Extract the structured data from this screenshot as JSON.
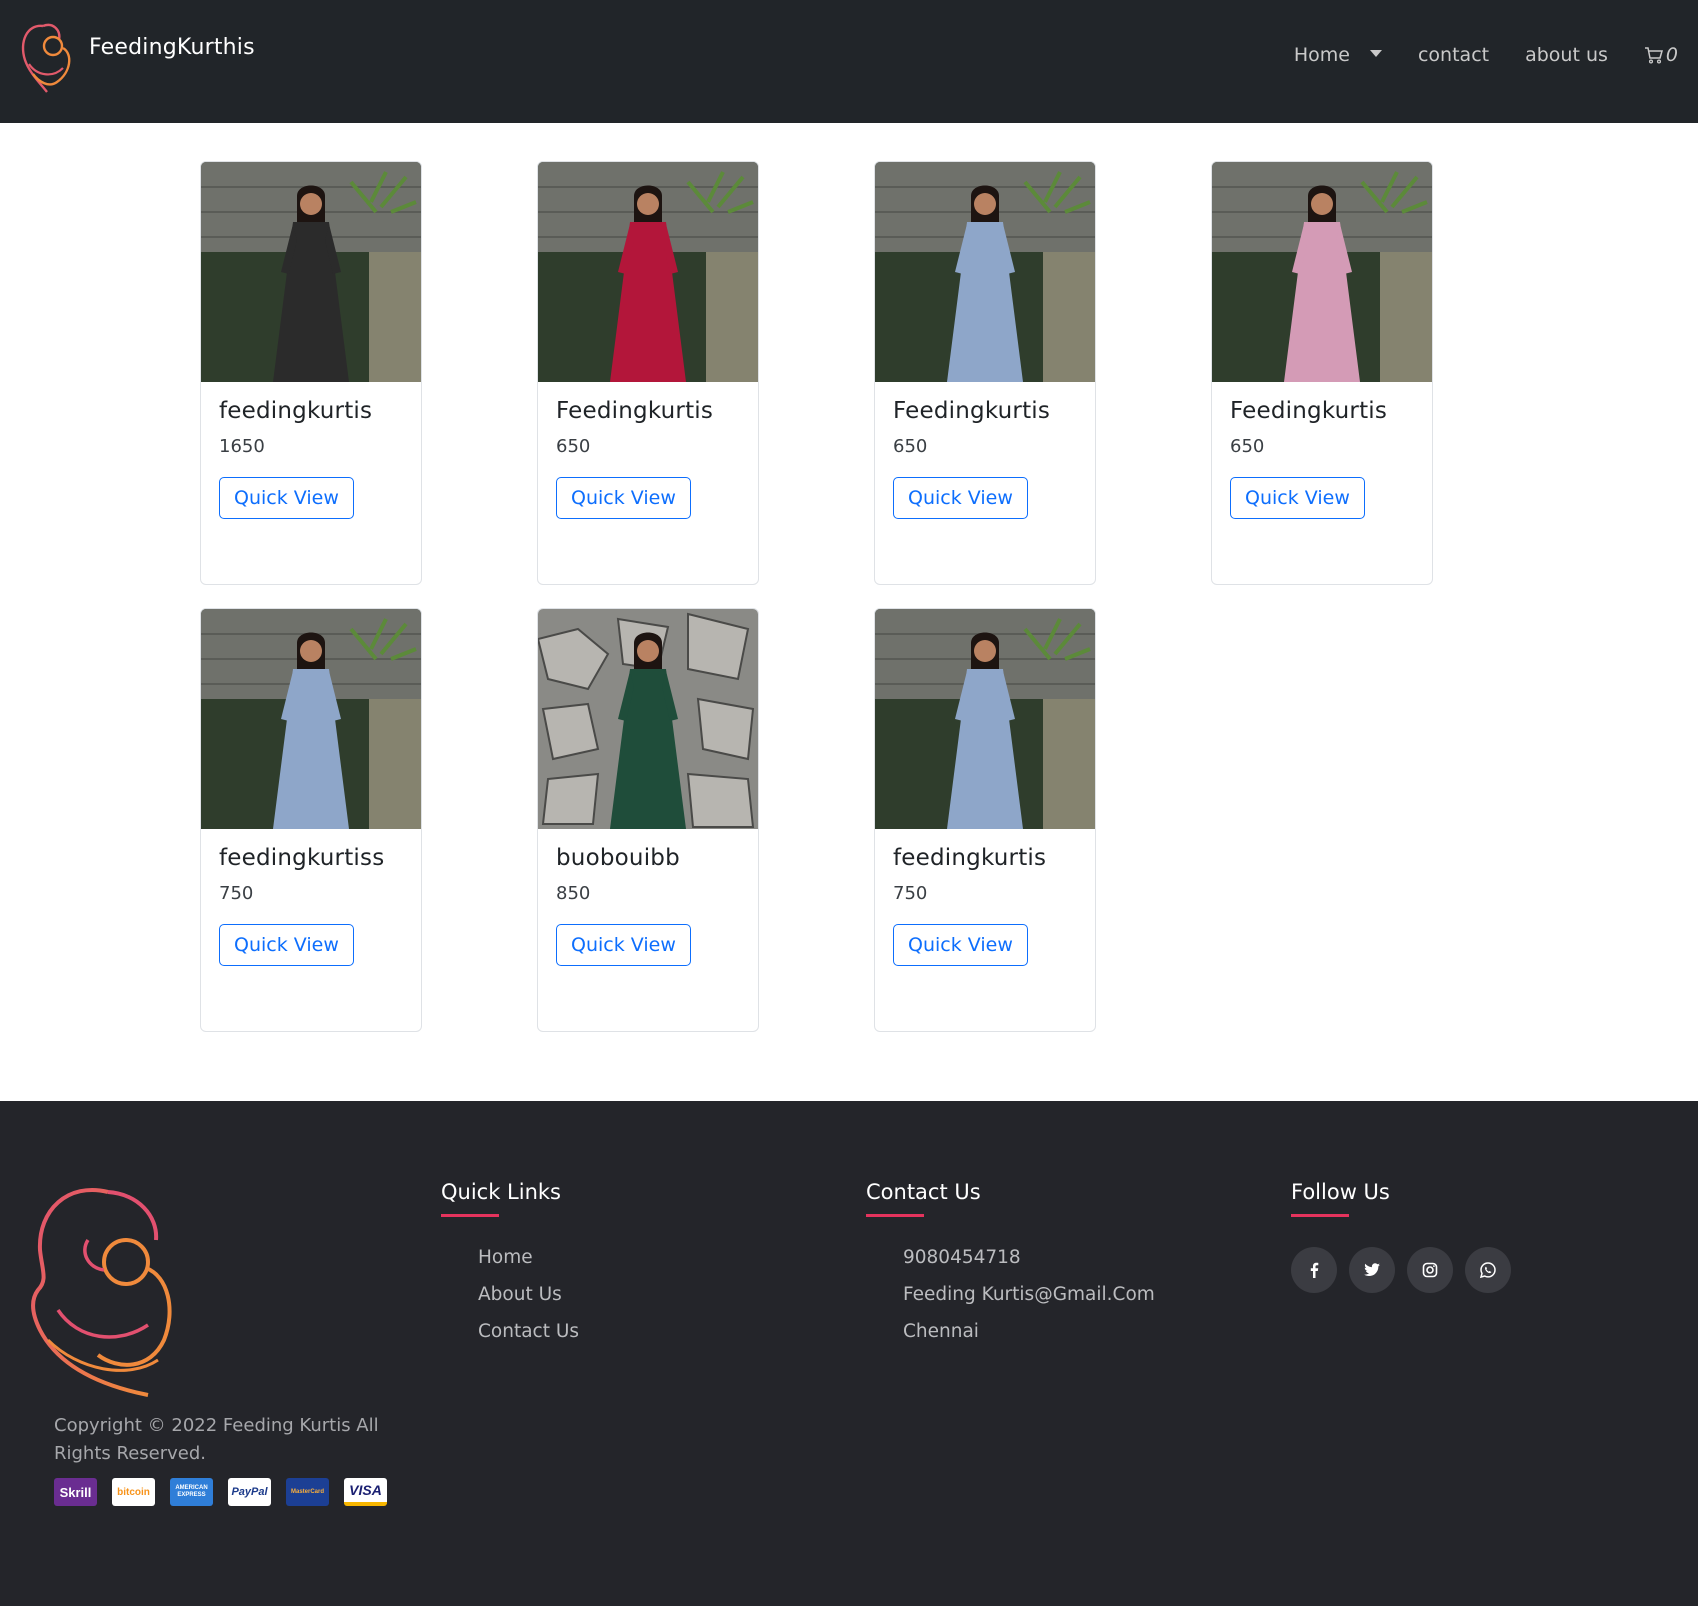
{
  "header": {
    "brand": "FeedingKurthis",
    "nav": [
      {
        "label": "Home",
        "dropdown": true
      },
      {
        "label": "contact"
      },
      {
        "label": "about us"
      }
    ],
    "cart_count": "0"
  },
  "products": [
    {
      "title": "feedingkurtis",
      "price": "1650",
      "button": "Quick View",
      "dress_color": "#2b2b2b"
    },
    {
      "title": "Feedingkurtis",
      "price": "650",
      "button": "Quick View",
      "dress_color": "#b3163a"
    },
    {
      "title": "Feedingkurtis",
      "price": "650",
      "button": "Quick View",
      "dress_color": "#8ea6c9"
    },
    {
      "title": "Feedingkurtis",
      "price": "650",
      "button": "Quick View",
      "dress_color": "#d49bb6"
    },
    {
      "title": "feedingkurtiss",
      "price": "750",
      "button": "Quick View",
      "dress_color": "#8ea6c9"
    },
    {
      "title": "buobouibb",
      "price": "850",
      "button": "Quick View",
      "dress_color": "#1f4d3a"
    },
    {
      "title": "feedingkurtis",
      "price": "750",
      "button": "Quick View",
      "dress_color": "#8ea6c9"
    }
  ],
  "footer": {
    "copyright": "Copyright © 2022 Feeding Kurtis All Rights Reserved.",
    "payments": [
      "Skrill",
      "bitcoin",
      "AMERICAN EXPRESS",
      "PayPal",
      "MasterCard",
      "VISA"
    ],
    "quick_links": {
      "title": "Quick Links",
      "items": [
        "Home",
        "About Us",
        "Contact Us"
      ]
    },
    "contact": {
      "title": "Contact Us",
      "items": [
        "9080454718",
        "Feeding Kurtis@Gmail.Com",
        "Chennai"
      ]
    },
    "follow": {
      "title": "Follow Us",
      "icons": [
        "facebook-icon",
        "twitter-icon",
        "instagram-icon",
        "whatsapp-icon"
      ]
    }
  },
  "colors": {
    "navbar_bg": "#212529",
    "footer_bg": "#24252a",
    "accent": "#e5335d",
    "button_blue": "#0d6efd"
  }
}
